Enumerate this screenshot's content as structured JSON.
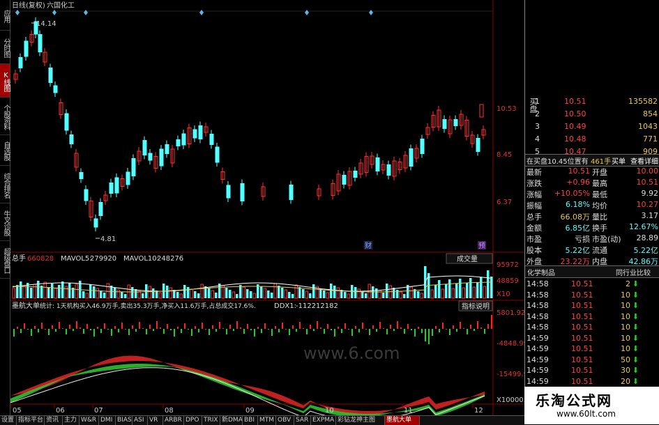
{
  "sidebar": [
    {
      "label": "应用",
      "active": false
    },
    {
      "label": "分时图",
      "active": false
    },
    {
      "label": "K线图",
      "active": true
    },
    {
      "label": "个股资料",
      "active": false
    },
    {
      "label": "自选股",
      "active": false
    },
    {
      "label": "综合排名",
      "active": false
    },
    {
      "label": "牛叉诊股",
      "active": false
    },
    {
      "label": "超级盘口",
      "active": false
    }
  ],
  "kline": {
    "title": "日线(复权)",
    "stock_name": "六国化工",
    "high_label": "14.14",
    "low_label": "4.81",
    "price_axis": [
      "10.53",
      "8.45",
      "6.37"
    ],
    "markers": [
      "财",
      "预"
    ]
  },
  "volume": {
    "label": "总手",
    "value": "660828",
    "ma5_label": "MAVOL5:",
    "ma5": "279920",
    "ma10_label": "MAVOL10:",
    "ma10": "248276",
    "dropdown": "成交量",
    "axis": [
      "95972",
      "48859",
      "X10"
    ]
  },
  "indicator": {
    "name": "墨航大单",
    "stats": "统计: 1天机构买入46.9万手,卖出35.3万手,净买入11.6万手,占总成交17.6%.",
    "ddx_label": "DDX1:",
    "ddx_value": "-112212182",
    "button": "指标说明",
    "axis": [
      "5801.92",
      "-4848.99",
      "-15499.9",
      "X10000.0"
    ],
    "watermark": "www.6.com"
  },
  "x_axis": [
    "05",
    "06",
    "07",
    "08",
    "09",
    "10",
    "11",
    "12"
  ],
  "bottom_tabs": [
    "设置",
    "指标平台",
    "资讯",
    "主力",
    "W&R",
    "DMI",
    "BIAS",
    "ASI",
    "VR",
    "ARBR",
    "DPO",
    "TRIX",
    "新DMA",
    "BBI",
    "MTM",
    "OBV",
    "SAR",
    "EXPMA",
    "彩钻龙神主图",
    "墨航大单"
  ],
  "bid_book": {
    "side_label": "买盘",
    "rows": [
      {
        "level": "1",
        "price": "10.51",
        "volume": "135582"
      },
      {
        "level": "2",
        "price": "10.50",
        "volume": "854"
      },
      {
        "level": "3",
        "price": "10.49",
        "volume": "1043"
      },
      {
        "level": "4",
        "price": "10.48",
        "volume": "771"
      },
      {
        "level": "5",
        "price": "10.47",
        "volume": "909"
      }
    ]
  },
  "queue": {
    "text": "在买盘10.45位置有",
    "count": "461手",
    "button1": "买单",
    "button2": "查看详细"
  },
  "quote": [
    {
      "l1": "最新",
      "v1": "10.51",
      "l2": "开盘",
      "v2": "10.00"
    },
    {
      "l1": "涨跌",
      "v1": "+0.96",
      "l2": "最高",
      "v2": "10.51"
    },
    {
      "l1": "涨幅",
      "v1": "+10.05%",
      "l2": "最低",
      "v2": "9.92"
    },
    {
      "l1": "振幅",
      "v1": "6.18%",
      "l2": "均价",
      "v2": "10.27"
    },
    {
      "l1": "总手",
      "v1": "66.08万",
      "l2": "量比",
      "v2": "3.17"
    },
    {
      "l1": "金额",
      "v1": "6.85亿",
      "l2": "换手",
      "v2": "12.67%"
    },
    {
      "l1": "市盈",
      "v1": "亏损",
      "l2": "市盈(动)",
      "v2": "28.89"
    },
    {
      "l1": "股本",
      "v1": "5.22亿",
      "l2": "流通",
      "v2": "5.22亿"
    },
    {
      "l1": "外盘",
      "v1": "23.22万",
      "l2": "内盘",
      "v2": "42.86万"
    }
  ],
  "industry": {
    "tab1": "化学制品",
    "tab2": "同行业比较"
  },
  "ticks": [
    {
      "time": "14:58",
      "price": "10.51",
      "vol": "2"
    },
    {
      "time": "14:58",
      "price": "10.51",
      "vol": "10"
    },
    {
      "time": "14:58",
      "price": "10.51",
      "vol": "10"
    },
    {
      "time": "14:58",
      "price": "10.51",
      "vol": "10"
    },
    {
      "time": "14:58",
      "price": "10.51",
      "vol": "10"
    },
    {
      "time": "14:59",
      "price": "10.51",
      "vol": "10"
    },
    {
      "time": "14:59",
      "price": "10.51",
      "vol": "10"
    },
    {
      "time": "14:59",
      "price": "10.51",
      "vol": "50"
    },
    {
      "time": "14:59",
      "price": "10.51",
      "vol": "30"
    },
    {
      "time": "14:59",
      "price": "10.51",
      "vol": "20"
    }
  ],
  "brand": {
    "name": "乐淘公式网",
    "url": "www.60lt.com"
  }
}
